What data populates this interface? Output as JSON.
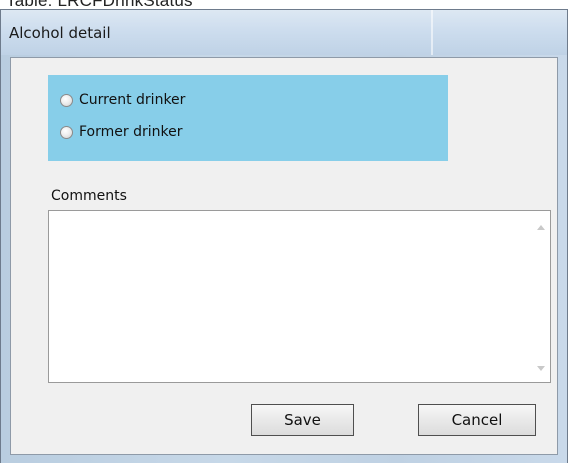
{
  "caption": "Table: LRCFDrinkStatus",
  "window": {
    "title": "Alcohol detail"
  },
  "radio_group": {
    "options": [
      {
        "label": "Current drinker",
        "selected": false
      },
      {
        "label": "Former drinker",
        "selected": false
      }
    ]
  },
  "comments": {
    "label": "Comments",
    "value": ""
  },
  "buttons": {
    "save_label": "Save",
    "cancel_label": "Cancel"
  },
  "colors": {
    "radio_panel_bg": "#87cee9"
  }
}
